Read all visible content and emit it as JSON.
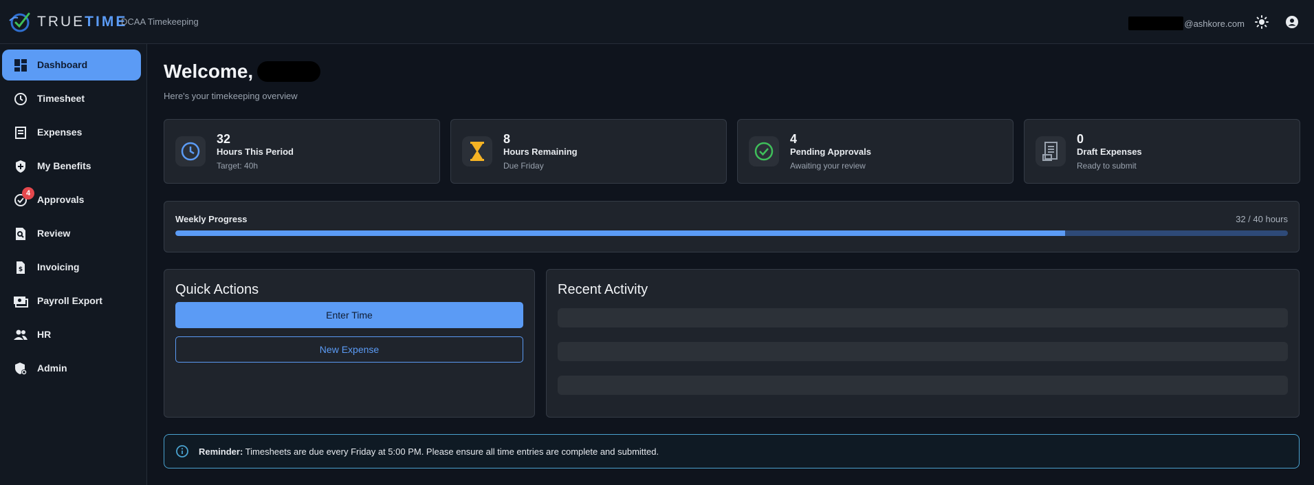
{
  "header": {
    "brand_left": "TRUE",
    "brand_right": "TIME",
    "subtitle": "DCAA Timekeeping",
    "user_email_domain": "@ashkore.com",
    "theme_icon": "sun-icon",
    "account_icon": "account-circle-icon"
  },
  "sidebar": {
    "items": [
      {
        "label": "Dashboard",
        "icon": "dashboard-icon"
      },
      {
        "label": "Timesheet",
        "icon": "clock-icon"
      },
      {
        "label": "Expenses",
        "icon": "receipt-icon"
      },
      {
        "label": "My Benefits",
        "icon": "shield-plus-icon"
      },
      {
        "label": "Approvals",
        "icon": "check-circle-icon",
        "badge": "4"
      },
      {
        "label": "Review",
        "icon": "document-search-icon"
      },
      {
        "label": "Invoicing",
        "icon": "invoice-dollar-icon"
      },
      {
        "label": "Payroll Export",
        "icon": "cash-icon"
      },
      {
        "label": "HR",
        "icon": "people-icon"
      },
      {
        "label": "Admin",
        "icon": "admin-shield-icon"
      }
    ]
  },
  "main": {
    "welcome": "Welcome,",
    "overview": "Here's your timekeeping overview",
    "stats": [
      {
        "value": "32",
        "label": "Hours This Period",
        "sub": "Target: 40h",
        "icon": "clock-icon"
      },
      {
        "value": "8",
        "label": "Hours Remaining",
        "sub": "Due Friday",
        "icon": "hourglass-icon"
      },
      {
        "value": "4",
        "label": "Pending Approvals",
        "sub": "Awaiting your review",
        "icon": "check-circle-icon"
      },
      {
        "value": "0",
        "label": "Draft Expenses",
        "sub": "Ready to submit",
        "icon": "receipt-icon"
      }
    ],
    "progress": {
      "title": "Weekly Progress",
      "text": "32 / 40 hours",
      "fraction": 0.8
    },
    "quick_actions": {
      "title": "Quick Actions",
      "enter_time": "Enter Time",
      "new_expense": "New Expense"
    },
    "recent_activity": {
      "title": "Recent Activity"
    },
    "reminder": {
      "label": "Reminder:",
      "text": " Timesheets are due every Friday at 5:00 PM. Please ensure all time entries are complete and submitted."
    }
  },
  "colors": {
    "accent": "#5b9bf5",
    "badge": "#e5484d",
    "hourglass": "#f5b324",
    "check": "#3fbf5a"
  }
}
